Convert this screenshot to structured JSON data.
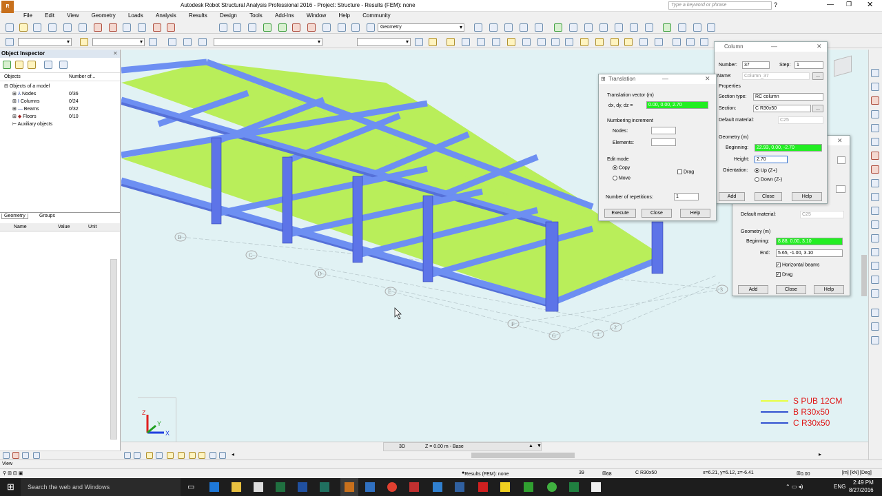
{
  "window": {
    "title": "Autodesk Robot Structural Analysis Professional 2016 - Project: Structure - Results (FEM): none",
    "search_placeholder": "Type a keyword or phrase"
  },
  "menu": [
    "File",
    "Edit",
    "View",
    "Geometry",
    "Loads",
    "Analysis",
    "Results",
    "Design",
    "Tools",
    "Add-Ins",
    "Window",
    "Help",
    "Community"
  ],
  "toolbar": {
    "layout_combo": "Geometry"
  },
  "object_inspector": {
    "title": "Object Inspector",
    "columns": [
      "Objects",
      "Number of..."
    ],
    "tree": [
      {
        "label": "Objects of a model",
        "count": ""
      },
      {
        "label": "Nodes",
        "count": "0/36"
      },
      {
        "label": "Columns",
        "count": "0/24"
      },
      {
        "label": "Beams",
        "count": "0/32"
      },
      {
        "label": "Floors",
        "count": "0/10"
      },
      {
        "label": "Auxiliary objects",
        "count": ""
      }
    ],
    "tabs": [
      "Geometry",
      "Groups"
    ],
    "table_headers": [
      "Name",
      "Value",
      "Unit"
    ]
  },
  "viewport": {
    "legend": [
      {
        "label": "S PUB 12CM",
        "color": "#e8ff40"
      },
      {
        "label": "B R30x50",
        "color": "#3050d0"
      },
      {
        "label": "C R30x50",
        "color": "#3050d0"
      }
    ],
    "grid_labels": [
      "B",
      "C",
      "D",
      "E",
      "F",
      "G",
      "1",
      "2",
      "3"
    ],
    "bottom_bar": {
      "mode": "3D",
      "level": "Z = 0.00 m - Base"
    }
  },
  "translation_dialog": {
    "title": "Translation",
    "vector_label": "Translation vector (m)",
    "vector_prefix": "dx, dy, dz  =",
    "vector_value": "0.00, 0.00, 2.70",
    "numbering_label": "Numbering increment",
    "nodes_label": "Nodes:",
    "elements_label": "Elements:",
    "edit_mode_label": "Edit mode",
    "copy_label": "Copy",
    "move_label": "Move",
    "drag_label": "Drag",
    "repetitions_label": "Number of repetitions:",
    "repetitions_value": "1",
    "execute": "Execute",
    "close": "Close",
    "help": "Help"
  },
  "column_dialog": {
    "title": "Column",
    "number_label": "Number:",
    "number_value": "37",
    "step_label": "Step:",
    "step_value": "1",
    "name_label": "Name:",
    "name_value": "Column_37",
    "properties_label": "Properties",
    "section_type_label": "Section type:",
    "section_type_value": "RC column",
    "section_label": "Section:",
    "section_value": "C R30x50",
    "material_label": "Default material:",
    "material_value": "C25",
    "geometry_label": "Geometry (m)",
    "beginning_label": "Beginning:",
    "beginning_value": "22.93, 0.00, -2.70",
    "height_label": "Height:",
    "height_value": "2.70",
    "orientation_label": "Orientation:",
    "up_label": "Up (Z+)",
    "down_label": "Down (Z-)",
    "add": "Add",
    "close": "Close",
    "help": "Help"
  },
  "beam_dialog": {
    "material_label": "Default material:",
    "material_value": "C25",
    "geometry_label": "Geometry (m)",
    "beginning_label": "Beginning:",
    "beginning_value": "8.88, 0.00, 3.10",
    "end_label": "End:",
    "end_value": "5.65, -1.00, 3.10",
    "horizontal_label": "Horizontal beams",
    "drag_label": "Drag",
    "add": "Add",
    "close": "Close",
    "help": "Help"
  },
  "status": {
    "view": "View",
    "results": "Results (FEM): none",
    "n1": "39",
    "n2": "68",
    "section": "C R30x50",
    "coords": "x=6.21, y=6.12, z=-6.41",
    "angle": "0.00",
    "units": "[m] [kN] [Deg]"
  },
  "taskbar": {
    "search": "Search the web and Windows",
    "lang": "ENG",
    "time": "2:49 PM",
    "date": "8/27/2016"
  }
}
